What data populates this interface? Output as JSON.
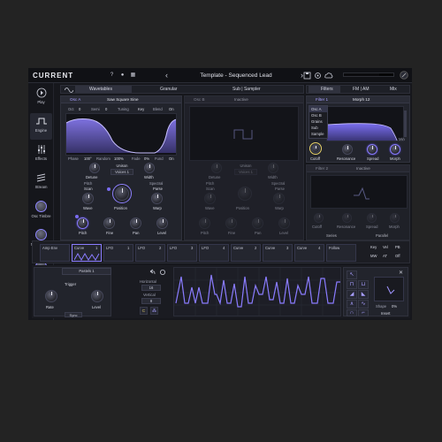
{
  "app": {
    "logo": "CURRENT",
    "preset_name": "Template - Sequenced Lead"
  },
  "topbar": {
    "help": "?",
    "user": "●",
    "grid": "▦",
    "prev": "‹",
    "next": "›"
  },
  "sidebar": {
    "items": [
      {
        "label": "Play"
      },
      {
        "label": "Engine"
      },
      {
        "label": "Effects"
      },
      {
        "label": "Stream"
      },
      {
        "label": "Osc Timbre"
      },
      {
        "label": "Morph Filter"
      },
      {
        "label": "Delay"
      },
      {
        "label": "Chorus"
      }
    ]
  },
  "tabs": {
    "wavetables": "Wavetables",
    "granular": "Granular",
    "sub_sampler": "Sub | Sampler",
    "filters": "Filters",
    "fm_am": "FM | AM",
    "mix": "Mix"
  },
  "osc_a": {
    "title": "Osc A",
    "wave_name": "Saw Square Sine",
    "oct_label": "Oct",
    "oct_value": "0",
    "semi_label": "Semi",
    "semi_value": "0",
    "tuning_label": "Tuning",
    "tuning_value": "Key",
    "blend_label": "Blend",
    "blend_value": "On",
    "phase_label": "Phase",
    "phase_value": "100°",
    "random_label": "Random",
    "random_value": "100%",
    "fade_label": "Fade",
    "fade_value": "0%",
    "fund_label": "Fund",
    "fund_value": "On",
    "unison_label": "Unison",
    "voices_value": "Voices 1",
    "detune_label": "Detune",
    "width_label": "Width",
    "pitch_label": "Pitch",
    "scan_label": "Scan",
    "spectral_label": "Spectral",
    "parse_label": "Parse",
    "wave_label": "Wave",
    "position_label": "Position",
    "warp_label": "Warp",
    "pitch2_label": "Pitch",
    "fine_label": "Fine",
    "pan_label": "Pan",
    "level_label": "Level"
  },
  "osc_b": {
    "title": "Osc B",
    "state": "Inactive",
    "unison_label": "Unison",
    "voices_value": "Voices 1",
    "detune_label": "Detune",
    "width_label": "Width",
    "pitch_label": "Pitch",
    "scan_label": "Scan",
    "spectral_label": "Spectral",
    "parse_label": "Parse",
    "wave_label": "Wave",
    "position_label": "Position",
    "warp_label": "Warp",
    "pitch2_label": "Pitch",
    "fine_label": "Fine",
    "pan_label": "Pan",
    "level_label": "Level"
  },
  "filter1": {
    "title": "Filter 1",
    "type": "Morph 12",
    "sources": [
      "Osc A",
      "Osc B",
      "Grains",
      "Sub",
      "Sample"
    ],
    "selected_source": "Osc A",
    "cutoff_label": "Cutoff",
    "resonance_label": "Resonance",
    "spread_label": "Spread",
    "morph_label": "Morph",
    "side_label": "Min"
  },
  "filter2": {
    "title": "Filter 2",
    "state": "Inactive",
    "cutoff_label": "Cutoff",
    "resonance_label": "Resonance",
    "spread_label": "Spread",
    "morph_label": "Morph",
    "series_label": "Series",
    "parallel_label": "Parallel"
  },
  "mod_slots": [
    {
      "label": "Amp Env"
    },
    {
      "label": "Curve",
      "num": "1"
    },
    {
      "label": "LFO",
      "num": "1"
    },
    {
      "label": "LFO",
      "num": "2"
    },
    {
      "label": "LFO",
      "num": "3"
    },
    {
      "label": "LFO",
      "num": "4"
    },
    {
      "label": "Curve",
      "num": "2"
    },
    {
      "label": "Curve",
      "num": "3"
    },
    {
      "label": "Curve",
      "num": "4"
    },
    {
      "label": "Follow",
      "num": ""
    }
  ],
  "mod_right": [
    "Key",
    "Vel",
    "PB",
    "MW",
    "AT",
    "Off"
  ],
  "bottom": {
    "trigger_label": "Trigger",
    "rate_label": "Rate",
    "level_label": "Level",
    "sync_label": "Sync",
    "pattern_name": "Pastels 1",
    "horizontal_label": "Horizontal",
    "horizontal_value": "16",
    "vertical_label": "Vertical",
    "vertical_value": "8",
    "shape_label": "Shape",
    "shape_value": "0%",
    "insert_label": "Insert",
    "close": "✕"
  }
}
